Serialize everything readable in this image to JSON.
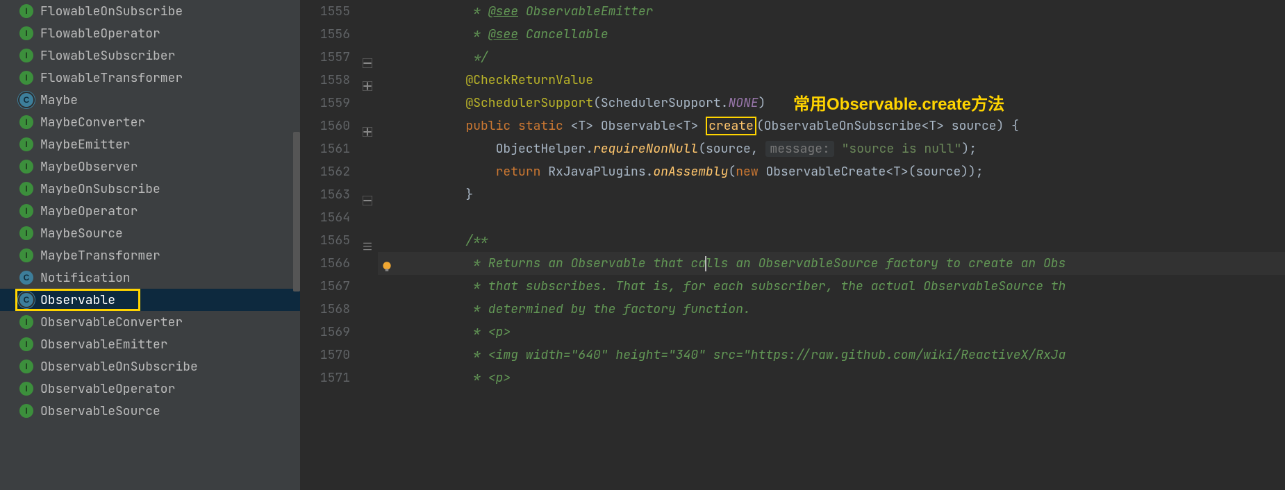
{
  "sidebar": {
    "items": [
      {
        "kind": "interface",
        "label": "FlowableOnSubscribe"
      },
      {
        "kind": "interface",
        "label": "FlowableOperator"
      },
      {
        "kind": "interface",
        "label": "FlowableSubscriber"
      },
      {
        "kind": "interface",
        "label": "FlowableTransformer"
      },
      {
        "kind": "class",
        "label": "Maybe",
        "ring": true
      },
      {
        "kind": "interface",
        "label": "MaybeConverter"
      },
      {
        "kind": "interface",
        "label": "MaybeEmitter"
      },
      {
        "kind": "interface",
        "label": "MaybeObserver"
      },
      {
        "kind": "interface",
        "label": "MaybeOnSubscribe"
      },
      {
        "kind": "interface",
        "label": "MaybeOperator"
      },
      {
        "kind": "interface",
        "label": "MaybeSource"
      },
      {
        "kind": "interface",
        "label": "MaybeTransformer"
      },
      {
        "kind": "class",
        "label": "Notification"
      },
      {
        "kind": "class",
        "label": "Observable",
        "ring": true,
        "selected": true
      },
      {
        "kind": "interface",
        "label": "ObservableConverter"
      },
      {
        "kind": "interface",
        "label": "ObservableEmitter"
      },
      {
        "kind": "interface",
        "label": "ObservableOnSubscribe"
      },
      {
        "kind": "interface",
        "label": "ObservableOperator"
      },
      {
        "kind": "interface",
        "label": "ObservableSource"
      }
    ]
  },
  "editor": {
    "annotation_callout": "常用Observable.create方法",
    "lines": [
      {
        "n": 1555
      },
      {
        "n": 1556
      },
      {
        "n": 1557
      },
      {
        "n": 1558
      },
      {
        "n": 1559
      },
      {
        "n": 1560
      },
      {
        "n": 1561
      },
      {
        "n": 1562
      },
      {
        "n": 1563
      },
      {
        "n": 1564
      },
      {
        "n": 1565
      },
      {
        "n": 1566
      },
      {
        "n": 1567
      },
      {
        "n": 1568
      },
      {
        "n": 1569
      },
      {
        "n": 1570
      },
      {
        "n": 1571
      }
    ],
    "c": {
      "star": " * ",
      "see": "@see",
      "obsEmitter": "ObservableEmitter",
      "cancellable": "Cancellable",
      "endDoc": " */",
      "ann1": "@CheckReturnValue",
      "ann2": "@SchedulerSupport",
      "schedSup": "SchedulerSupport",
      "none": "NONE",
      "public": "public",
      "static": "static",
      "obs": "Observable",
      "create": "create",
      "obsOnSub": "ObservableOnSubscribe",
      "src": " source) {",
      "oh": "ObjectHelper.",
      "rnn": "requireNonNull",
      "srcArg": "(source, ",
      "msgHint": "message:",
      "srcNull": "\"source is null\"",
      "ret": "return",
      "rx": " RxJavaPlugins.",
      "onAsm": "onAssembly",
      "new": "new",
      "obsCreate": " ObservableCreate<",
      "tEnd": ">(source));",
      "brace": "}",
      "docStart": "/**",
      "d1": " * Returns an Observable that ca",
      "d1b": "lls an ObservableSource factory to create an Obs",
      "d2": " * that subscribes. That is, for each subscriber, the actual ObservableSource th",
      "d3": " * determined by the factory function.",
      "d4": " * <p>",
      "d5": " * <img width=\"640\" height=\"340\" src=\"https://raw.github.com/wiki/ReactiveX/RxJa",
      "d6": " * <p>",
      "lt": "<",
      "t": "T",
      "gt": "> ",
      "paren": ")",
      "dot": ".",
      "op": "(",
      "sp": " ",
      "semi": ");"
    }
  }
}
